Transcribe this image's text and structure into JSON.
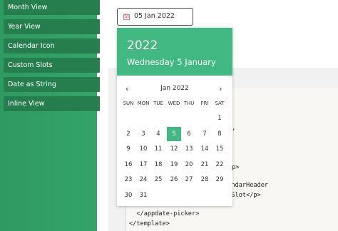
{
  "sidebar": {
    "items": [
      {
        "label": "Month View"
      },
      {
        "label": "Year View"
      },
      {
        "label": "Calendar Icon"
      },
      {
        "label": "Custom Slots"
      },
      {
        "label": "Date as String"
      },
      {
        "label": "Inline View"
      }
    ]
  },
  "date_input": {
    "value": "05 Jan 2022",
    "icon": "calendar-icon"
  },
  "picker": {
    "year": "2022",
    "full_date": "Wednesday 5 January",
    "month_label": "Jan 2022",
    "prev_icon": "chevron-left-icon",
    "next_icon": "chevron-right-icon",
    "weekdays": [
      "SUN",
      "MON",
      "TUE",
      "WED",
      "THU",
      "FRI",
      "SAT"
    ],
    "weeks": [
      [
        "",
        "",
        "",
        "",
        "",
        "",
        "1"
      ],
      [
        "2",
        "3",
        "4",
        "5",
        "6",
        "7",
        "8"
      ],
      [
        "9",
        "10",
        "11",
        "12",
        "13",
        "14",
        "15"
      ],
      [
        "16",
        "17",
        "18",
        "19",
        "20",
        "21",
        "22"
      ],
      [
        "23",
        "24",
        "25",
        "26",
        "27",
        "28",
        "29"
      ],
      [
        "30",
        "31",
        "",
        "",
        "",
        "",
        ""
      ]
    ],
    "selected_day": "5",
    "accent_color": "#42b883"
  },
  "code": {
    "lines": [
      {
        "text": "\"",
        "row": 0
      },
      {
        "text": "\",",
        "row": 1
      },
      {
        "text": "/p>",
        "row": 2
      },
      {
        "text": "lendarHeader",
        "row": 3
      },
      {
        "text": "r Slot</p>",
        "row": 4
      },
      {
        "text": "  </appdate-picker>",
        "row": 5
      },
      {
        "text": "</template>",
        "row": 6
      }
    ]
  }
}
